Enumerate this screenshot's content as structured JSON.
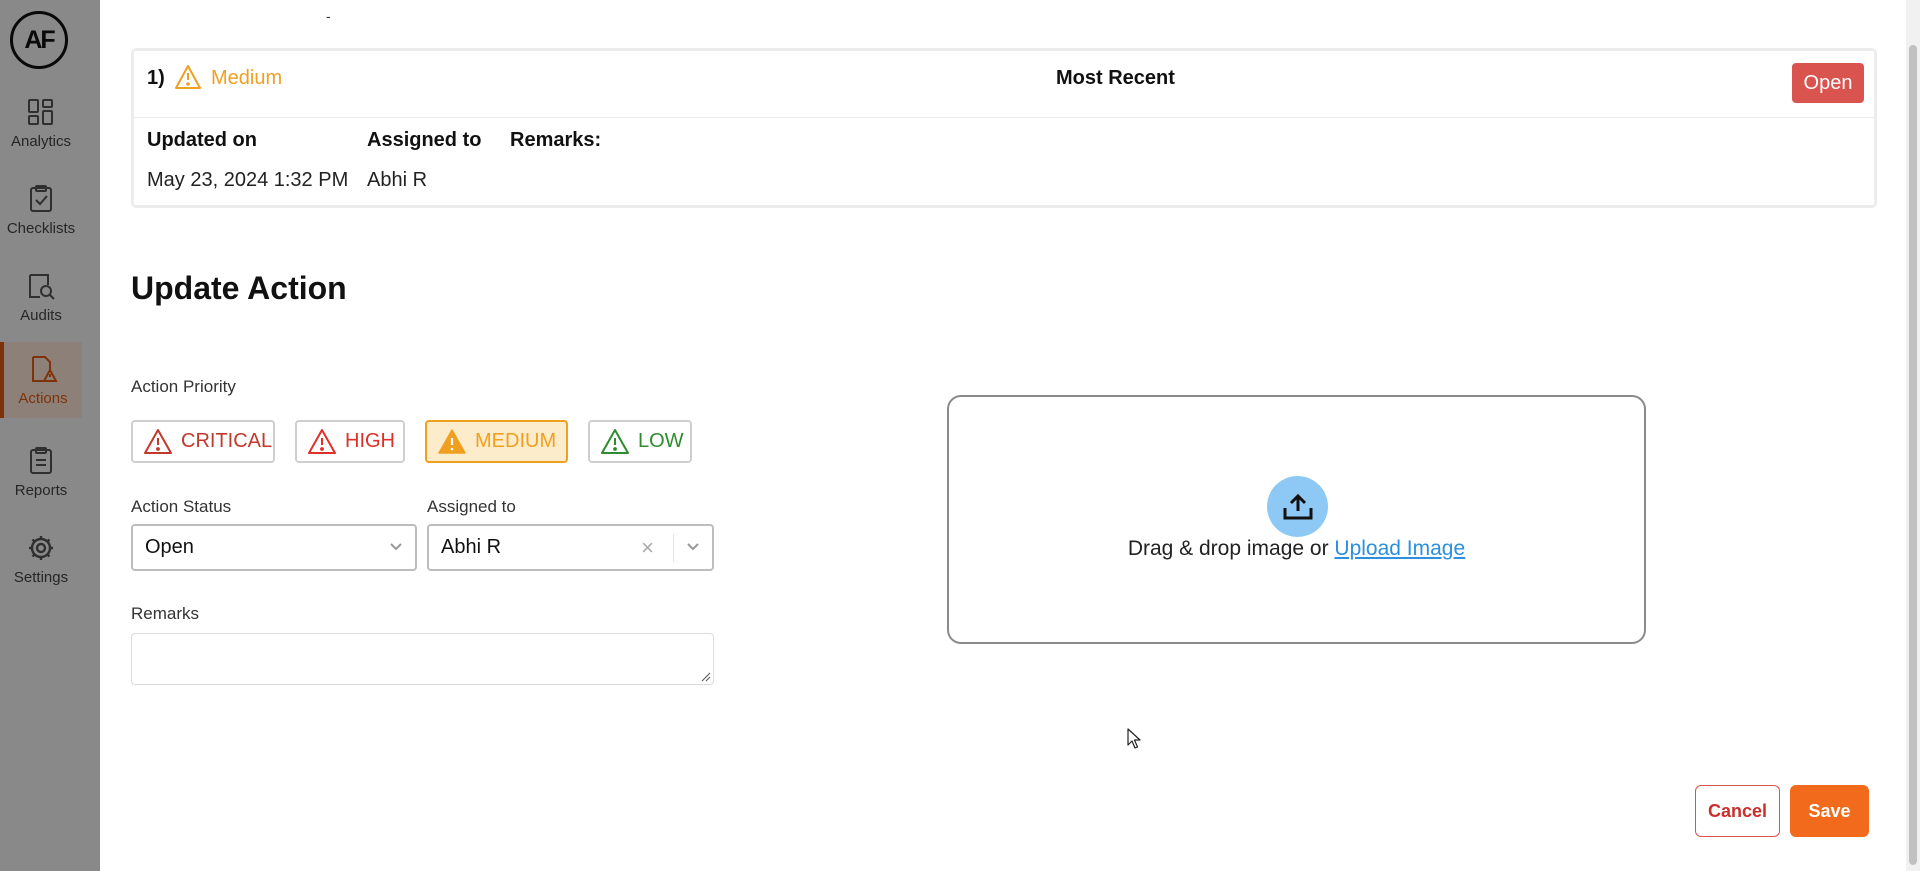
{
  "sidebar": {
    "logo_text": "AF",
    "items": [
      {
        "label": "Analytics",
        "icon": "analytics-icon"
      },
      {
        "label": "Checklists",
        "icon": "checklist-icon"
      },
      {
        "label": "Audits",
        "icon": "audit-icon"
      },
      {
        "label": "Actions",
        "icon": "actions-icon",
        "active": true
      },
      {
        "label": "Reports",
        "icon": "reports-icon"
      },
      {
        "label": "Settings",
        "icon": "gear-icon"
      }
    ]
  },
  "modal": {
    "top_dash": "-",
    "history": {
      "index": "1)",
      "priority": "Medium",
      "recent_label": "Most Recent",
      "status": "Open",
      "updated_label": "Updated on",
      "updated_value": "May 23, 2024 1:32 PM",
      "assigned_label": "Assigned to",
      "assigned_value": "Abhi R",
      "remarks_label": "Remarks:"
    },
    "form": {
      "title": "Update Action",
      "priority_label": "Action Priority",
      "priorities": [
        {
          "label": "CRITICAL",
          "color": "#c0392b"
        },
        {
          "label": "HIGH",
          "color": "#e0302a"
        },
        {
          "label": "MEDIUM",
          "color": "#f0a020",
          "selected": true
        },
        {
          "label": "LOW",
          "color": "#2e8b2e"
        }
      ],
      "status_label": "Action Status",
      "status_value": "Open",
      "assigned_label": "Assigned to",
      "assigned_value": "Abhi R",
      "remarks_label": "Remarks",
      "remarks_value": ""
    },
    "upload": {
      "text": "Drag & drop image or ",
      "link": "Upload Image"
    },
    "buttons": {
      "cancel": "Cancel",
      "save": "Save"
    }
  },
  "colors": {
    "accent": "#f26a1b",
    "danger": "#d9534f",
    "medium": "#f0a020"
  }
}
